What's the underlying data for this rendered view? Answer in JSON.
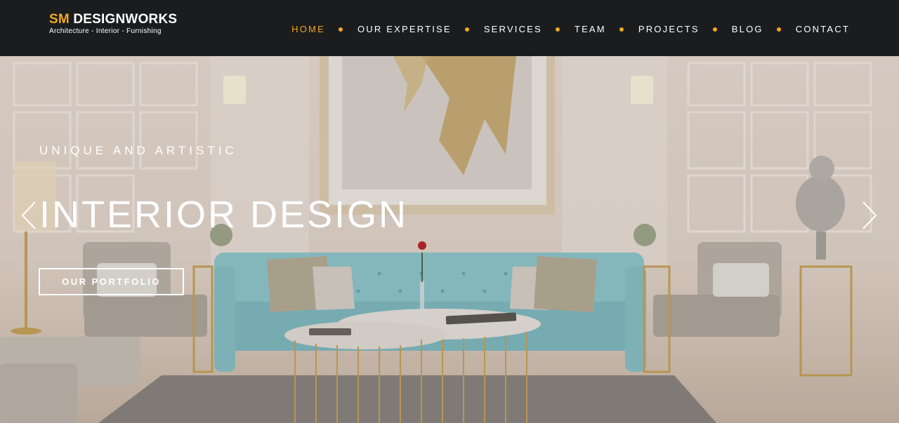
{
  "brand": {
    "name_accent": "SM",
    "name_rest": "DESIGNWORKS",
    "tagline": "Architecture - Interior - Furnishing"
  },
  "nav": {
    "items": [
      {
        "label": "HOME",
        "active": true
      },
      {
        "label": "OUR EXPERTISE",
        "active": false
      },
      {
        "label": "SERVICES",
        "active": false
      },
      {
        "label": "TEAM",
        "active": false
      },
      {
        "label": "PROJECTS",
        "active": false
      },
      {
        "label": "BLOG",
        "active": false
      },
      {
        "label": "CONTACT",
        "active": false
      }
    ]
  },
  "hero": {
    "eyebrow": "UNIQUE AND ARTISTIC",
    "title": "INTERIOR DESIGN",
    "button_label": "OUR PORTFOLIO",
    "prev_icon": "chevron-left-icon",
    "next_icon": "chevron-right-icon"
  },
  "colors": {
    "accent": "#f2a81d",
    "header_bg": "#1b1c1e",
    "text_light": "#ffffff"
  }
}
